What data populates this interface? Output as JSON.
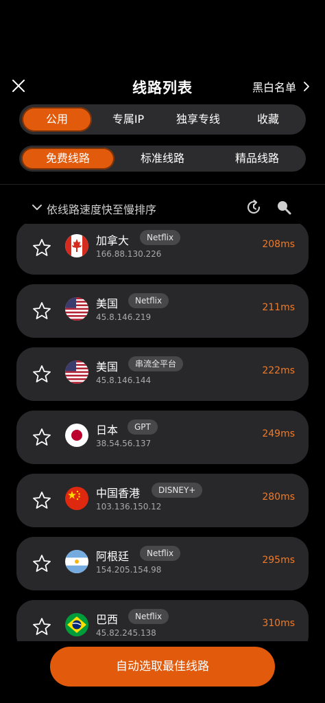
{
  "header": {
    "title": "线路列表",
    "right_label": "黑白名单"
  },
  "tabs_primary": [
    {
      "label": "公用",
      "active": true
    },
    {
      "label": "专属IP",
      "active": false
    },
    {
      "label": "独享专线",
      "active": false
    },
    {
      "label": "收藏",
      "active": false
    }
  ],
  "tabs_secondary": [
    {
      "label": "免费线路",
      "active": true
    },
    {
      "label": "标准线路",
      "active": false
    },
    {
      "label": "精品线路",
      "active": false
    }
  ],
  "sort": {
    "label": "依线路速度快至慢排序"
  },
  "servers": [
    {
      "name": "加拿大",
      "badge": "Netflix",
      "ip": "166.88.130.226",
      "latency": "208ms",
      "flag_icon": "canada-flag-icon"
    },
    {
      "name": "美国",
      "badge": "Netflix",
      "ip": "45.8.146.219",
      "latency": "211ms",
      "flag_icon": "usa-flag-icon"
    },
    {
      "name": "美国",
      "badge": "串流全平台",
      "ip": "45.8.146.144",
      "latency": "222ms",
      "flag_icon": "usa-flag-icon"
    },
    {
      "name": "日本",
      "badge": "GPT",
      "ip": "38.54.56.137",
      "latency": "249ms",
      "flag_icon": "japan-flag-icon"
    },
    {
      "name": "中国香港",
      "badge": "DISNEY+",
      "ip": "103.136.150.12",
      "latency": "280ms",
      "flag_icon": "china-flag-icon"
    },
    {
      "name": "阿根廷",
      "badge": "Netflix",
      "ip": "154.205.154.98",
      "latency": "295ms",
      "flag_icon": "argentina-flag-icon"
    },
    {
      "name": "巴西",
      "badge": "Netflix",
      "ip": "45.82.245.138",
      "latency": "310ms",
      "flag_icon": "brazil-flag-icon"
    }
  ],
  "cta": {
    "label": "自动选取最佳线路"
  },
  "colors": {
    "accent": "#e25a0b",
    "latency": "#ef7b2a",
    "card_bg": "#28282a",
    "segment_bg": "#2c2c2e"
  }
}
